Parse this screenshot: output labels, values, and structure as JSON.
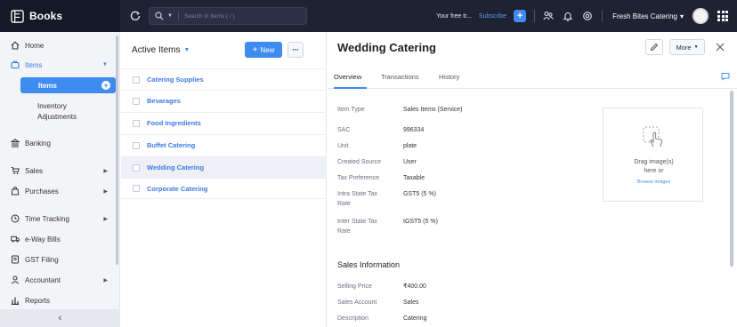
{
  "app": {
    "name": "Books"
  },
  "topbar": {
    "search_placeholder": "Search in Items ( / )",
    "trial_text": "Your free tr...",
    "subscribe_label": "Subscribe",
    "org_name": "Fresh Bites Catering",
    "org_caret": "▾"
  },
  "sidebar": {
    "home": "Home",
    "items_group": "Items",
    "items_sub": "Items",
    "inventory_line1": "Inventory",
    "inventory_line2": "Adjustments",
    "banking": "Banking",
    "sales": "Sales",
    "purchases": "Purchases",
    "time_tracking": "Time Tracking",
    "eway_bills": "e-Way Bills",
    "gst_filing": "GST Filing",
    "accountant": "Accountant",
    "reports": "Reports",
    "collapse_glyph": "‹"
  },
  "list": {
    "title": "Active Items",
    "new_label": "New",
    "more_glyph": "···",
    "items": [
      "Catering Supplies",
      "Bevarages",
      "Food Ingredients",
      "Buffet Catering",
      "Wedding Catering",
      "Corporate Catering"
    ],
    "selected_index": 4
  },
  "detail": {
    "title": "Wedding Catering",
    "more_label": "More",
    "tabs": [
      "Overview",
      "Transactions",
      "History"
    ],
    "active_tab": 0,
    "fields": {
      "item_type_label": "Item Type",
      "item_type_value": "Sales Items (Service)",
      "sac_label": "SAC",
      "sac_value": "996334",
      "unit_label": "Unit",
      "unit_value": "plate",
      "created_source_label": "Created Source",
      "created_source_value": "User",
      "tax_pref_label": "Tax Preference",
      "tax_pref_value": "Taxable",
      "intra_label_1": "Intra State Tax",
      "intra_label_2": "Rate",
      "intra_value": "GST5 (5 %)",
      "inter_label_1": "Inter State Tax",
      "inter_label_2": "Rate",
      "inter_value": "IGST5 (5 %)"
    },
    "sales_section_title": "Sales Information",
    "sales": {
      "selling_price_label": "Selling Price",
      "selling_price_value": "₹400.00",
      "sales_account_label": "Sales Account",
      "sales_account_value": "Sales",
      "description_label": "Description",
      "description_value": "Catering"
    },
    "image_drop": {
      "line1": "Drag image(s)",
      "line2": "here or",
      "browse": "Browse images"
    }
  },
  "colors": {
    "accent": "#3f8cf0",
    "topbar": "#1e2232",
    "sidebar_bg": "#f3f4f8"
  }
}
